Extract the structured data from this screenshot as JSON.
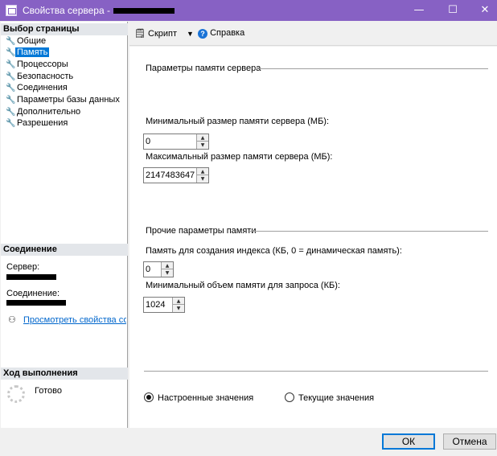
{
  "window": {
    "title": "Свойства сервера -",
    "controls": {
      "minimize": "—",
      "maximize": "☐",
      "close": "✕"
    }
  },
  "left_panel": {
    "page_select_header": "Выбор страницы",
    "nav_items": [
      {
        "label": "Общие",
        "selected": false
      },
      {
        "label": "Память",
        "selected": true
      },
      {
        "label": "Процессоры",
        "selected": false
      },
      {
        "label": "Безопасность",
        "selected": false
      },
      {
        "label": "Соединения",
        "selected": false
      },
      {
        "label": "Параметры базы данных",
        "selected": false
      },
      {
        "label": "Дополнительно",
        "selected": false
      },
      {
        "label": "Разрешения",
        "selected": false
      }
    ],
    "connection_header": "Соединение",
    "server_label": "Сервер:",
    "connection_label": "Соединение:",
    "view_connection_link": "Просмотреть свойства соединения",
    "progress_header": "Ход выполнения",
    "progress_status": "Готово"
  },
  "toolbar": {
    "script_label": "Скрипт",
    "help_label": "Справка",
    "dropdown_icon": "▼",
    "script_icon": "script-icon",
    "help_icon": "help-icon"
  },
  "content": {
    "server_memory_group": "Параметры памяти сервера",
    "min_memory_label": "Минимальный размер памяти сервера (МБ):",
    "min_memory_value": "0",
    "max_memory_label": "Максимальный размер памяти сервера (МБ):",
    "max_memory_value": "2147483647",
    "other_memory_group": "Прочие параметры памяти",
    "index_memory_label": "Память для создания индекса (КБ, 0 = динамическая память):",
    "index_memory_value": "0",
    "query_memory_label": "Минимальный объем памяти для запроса (КБ):",
    "query_memory_value": "1024",
    "radio_configured": "Настроенные значения",
    "radio_running": "Текущие значения",
    "selected_radio": "configured"
  },
  "footer": {
    "ok_label": "ОК",
    "cancel_label": "Отмена"
  },
  "colors": {
    "titlebar": "#8761c4",
    "selection": "#0078d7",
    "link": "#0066cc"
  }
}
